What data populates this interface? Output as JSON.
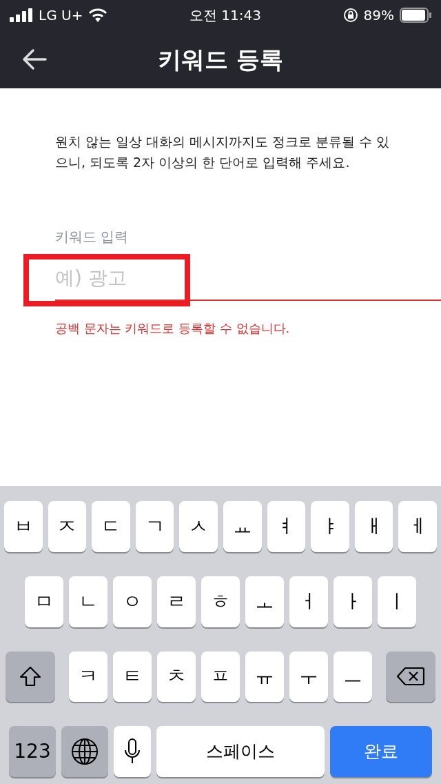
{
  "status_bar": {
    "carrier": "LG U+",
    "time": "오전 11:43",
    "battery_text": "89%",
    "battery": {
      "level": 0.89
    }
  },
  "header": {
    "title": "키워드 등록"
  },
  "notice": "원치 않는 일상 대화의 메시지까지도 정크로 분류될 수 있으니, 되도록 2자 이상의 한 단어로 입력해 주세요.",
  "keyword_field": {
    "label": "키워드 입력",
    "placeholder": "예) 광고",
    "highlighted": true,
    "error": "공백 문자는 키워드로 등록할 수 없습니다."
  },
  "keyboard": {
    "rows": [
      {
        "keys": [
          {
            "kind": "char",
            "label": "ㅂ"
          },
          {
            "kind": "char",
            "label": "ㅈ"
          },
          {
            "kind": "char",
            "label": "ㄷ"
          },
          {
            "kind": "char",
            "label": "ㄱ"
          },
          {
            "kind": "char",
            "label": "ㅅ"
          },
          {
            "kind": "char",
            "label": "ㅛ"
          },
          {
            "kind": "char",
            "label": "ㅕ"
          },
          {
            "kind": "char",
            "label": "ㅑ"
          },
          {
            "kind": "char",
            "label": "ㅐ"
          },
          {
            "kind": "char",
            "label": "ㅔ"
          }
        ]
      },
      {
        "keys": [
          {
            "kind": "char",
            "label": "ㅁ"
          },
          {
            "kind": "char",
            "label": "ㄴ"
          },
          {
            "kind": "char",
            "label": "ㅇ"
          },
          {
            "kind": "char",
            "label": "ㄹ"
          },
          {
            "kind": "char",
            "label": "ㅎ"
          },
          {
            "kind": "char",
            "label": "ㅗ"
          },
          {
            "kind": "char",
            "label": "ㅓ"
          },
          {
            "kind": "char",
            "label": "ㅏ"
          },
          {
            "kind": "char",
            "label": "ㅣ"
          }
        ]
      },
      {
        "keys": [
          {
            "kind": "shift"
          },
          {
            "kind": "char",
            "label": "ㅋ"
          },
          {
            "kind": "char",
            "label": "ㅌ"
          },
          {
            "kind": "char",
            "label": "ㅊ"
          },
          {
            "kind": "char",
            "label": "ㅍ"
          },
          {
            "kind": "char",
            "label": "ㅠ"
          },
          {
            "kind": "char",
            "label": "ㅜ"
          },
          {
            "kind": "char",
            "label": "ㅡ"
          },
          {
            "kind": "backspace"
          }
        ]
      },
      {
        "keys": [
          {
            "kind": "mode",
            "label": "123"
          },
          {
            "kind": "globe"
          },
          {
            "kind": "mic"
          },
          {
            "kind": "space",
            "label": "스페이스"
          },
          {
            "kind": "done",
            "label": "완료"
          }
        ]
      }
    ]
  }
}
